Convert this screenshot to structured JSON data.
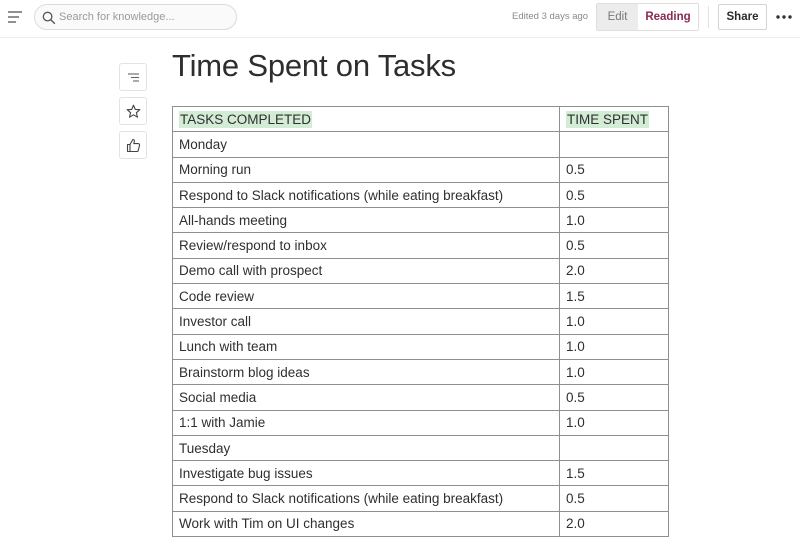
{
  "header": {
    "search_placeholder": "Search for knowledge...",
    "edited": "Edited 3 days ago",
    "edit_label": "Edit",
    "reading_label": "Reading",
    "share_label": "Share"
  },
  "icons": {
    "menu": "hamburger-menu-icon",
    "search": "search-icon",
    "more": "more-horizontal-icon",
    "outline": "outline-icon",
    "favorite": "star-icon",
    "like": "thumbs-up-icon"
  },
  "colors": {
    "accent": "#8a2a55",
    "highlight": "#d3ecd6"
  },
  "page": {
    "title": "Time Spent on Tasks",
    "table": {
      "headers": [
        "TASKS COMPLETED",
        "TIME SPENT"
      ],
      "rows": [
        {
          "task": "Monday",
          "time": "",
          "day": true
        },
        {
          "task": "Morning run",
          "time": "0.5"
        },
        {
          "task": "Respond to Slack notifications (while eating breakfast)",
          "time": "0.5"
        },
        {
          "task": "All-hands meeting",
          "time": "1.0"
        },
        {
          "task": "Review/respond to inbox",
          "time": "0.5"
        },
        {
          "task": "Demo call with prospect",
          "time": "2.0"
        },
        {
          "task": "Code review",
          "time": "1.5"
        },
        {
          "task": "Investor call",
          "time": "1.0"
        },
        {
          "task": "Lunch with team",
          "time": "1.0"
        },
        {
          "task": "Brainstorm blog ideas",
          "time": "1.0"
        },
        {
          "task": "Social media",
          "time": "0.5"
        },
        {
          "task": "1:1 with Jamie",
          "time": "1.0"
        },
        {
          "task": "Tuesday",
          "time": "",
          "day": true
        },
        {
          "task": "Investigate bug issues",
          "time": "1.5"
        },
        {
          "task": "Respond to Slack notifications (while eating breakfast)",
          "time": "0.5"
        },
        {
          "task": "Work with Tim on UI changes",
          "time": "2.0"
        }
      ]
    }
  }
}
